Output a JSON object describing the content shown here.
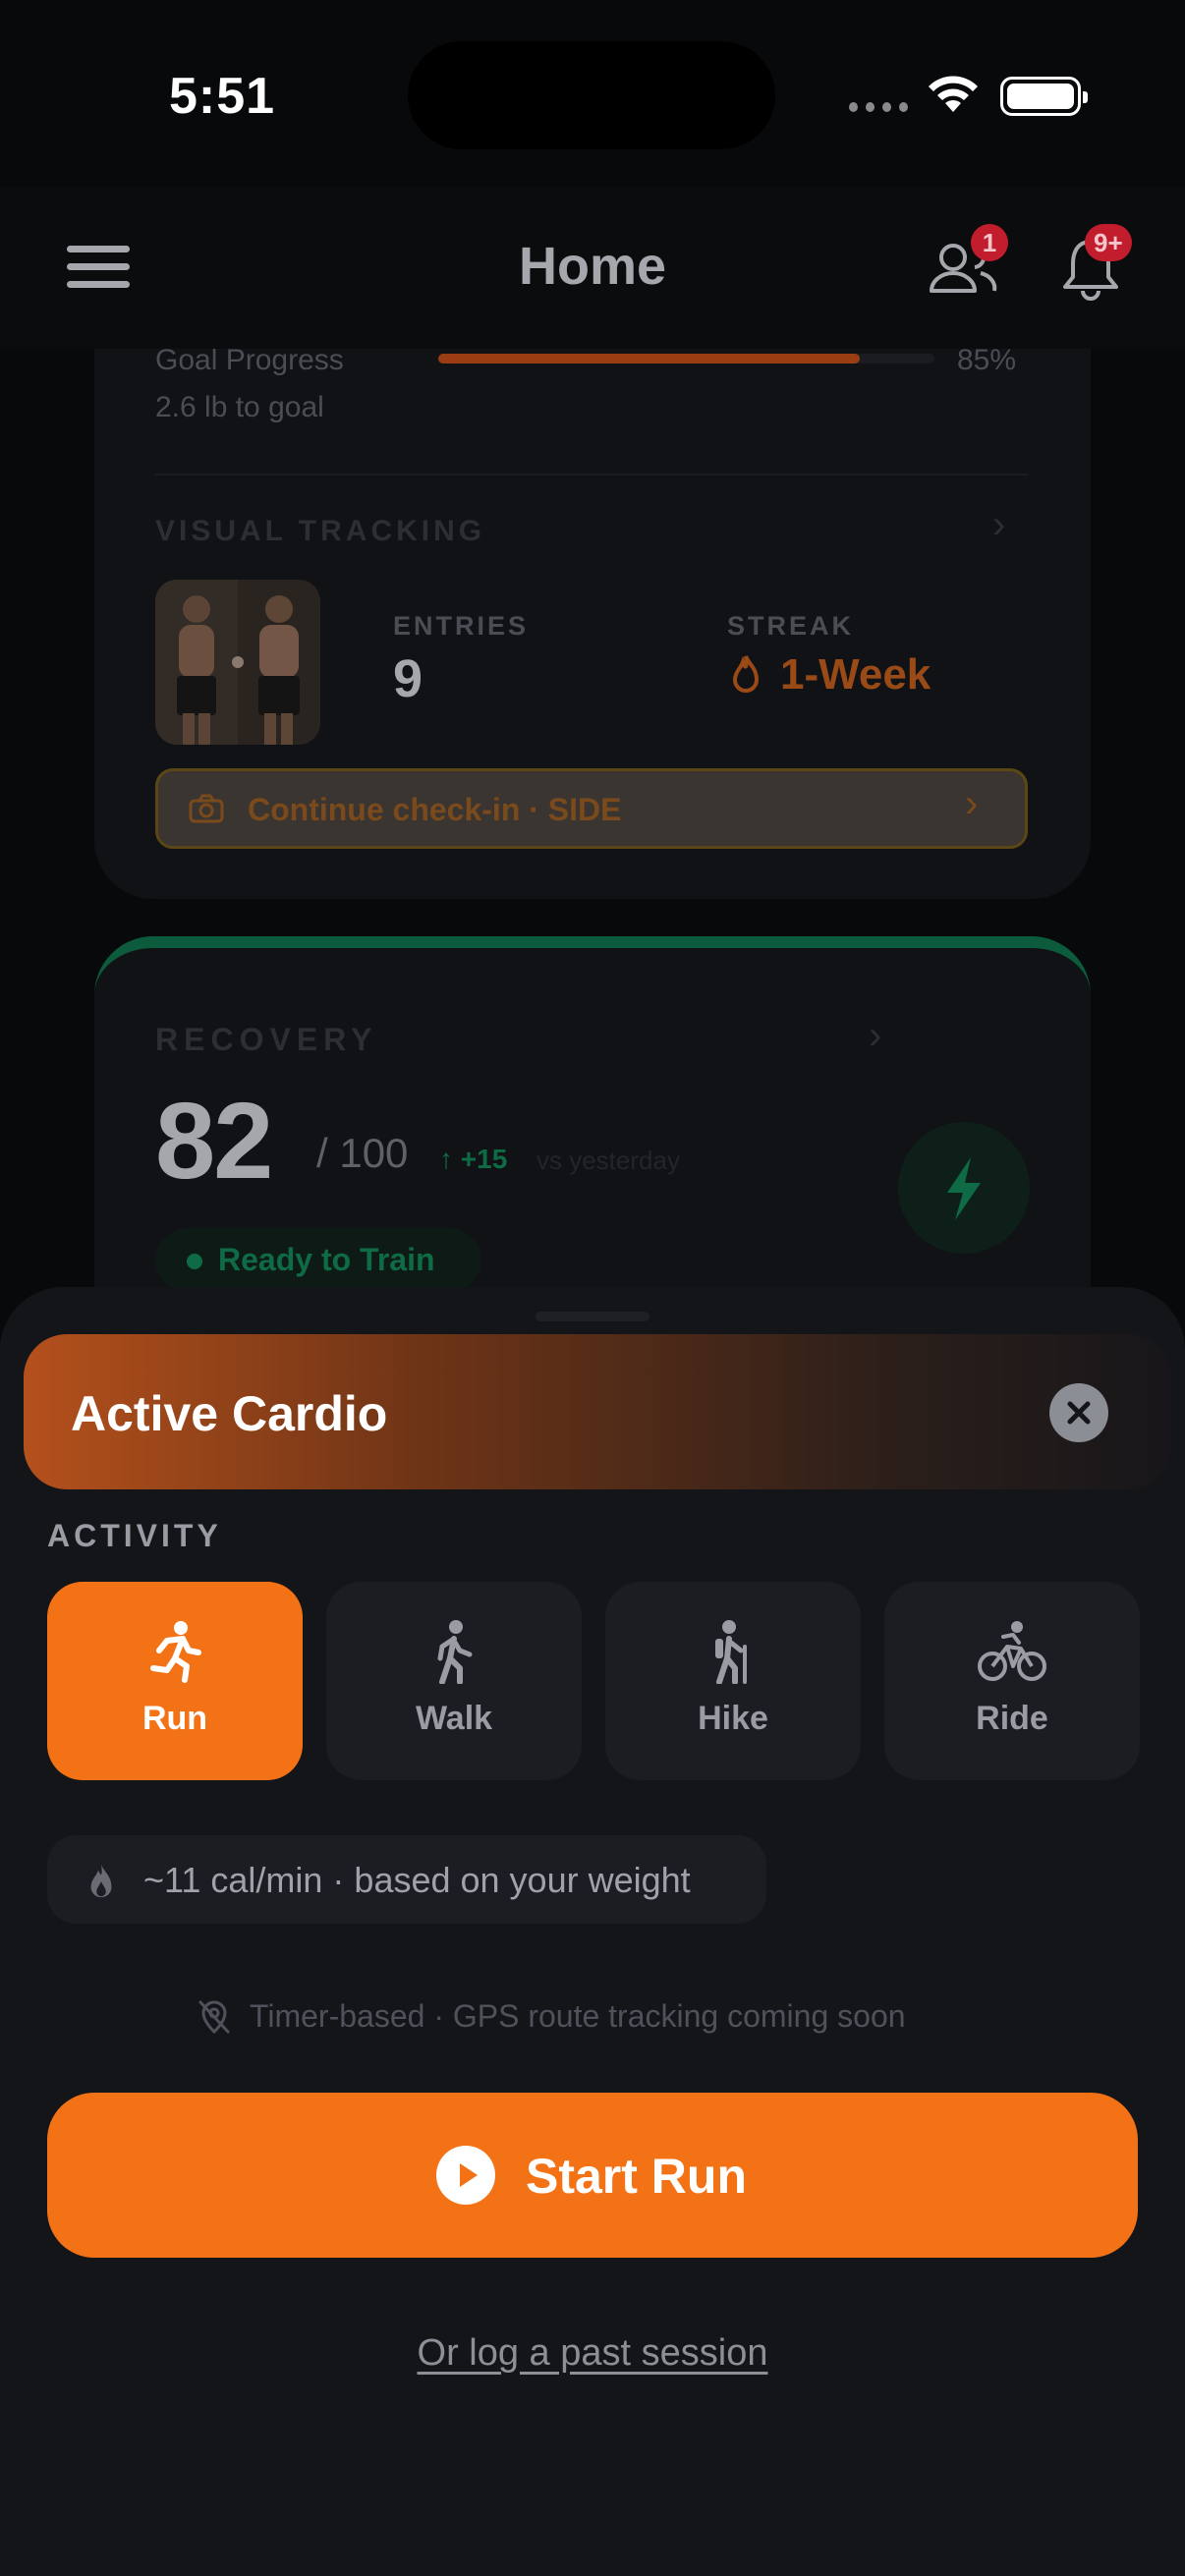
{
  "status_bar": {
    "time": "5:51"
  },
  "header": {
    "title": "Home",
    "friends_badge": "1",
    "notifications_badge": "9+"
  },
  "goal": {
    "label": "Goal Progress",
    "sub": "2.6 lb to goal",
    "percent_text": "85%",
    "progress": 0.85
  },
  "visual_tracking": {
    "label": "VISUAL TRACKING",
    "entries_label": "ENTRIES",
    "entries_value": "9",
    "streak_label": "STREAK",
    "streak_value": "1-Week",
    "checkin_label": "Continue check-in · SIDE"
  },
  "recovery": {
    "label": "RECOVERY",
    "score": "82",
    "max": "/ 100",
    "delta": "↑ +15",
    "delta_suffix": "vs yesterday",
    "status": "Ready to Train"
  },
  "sheet": {
    "title": "Active Cardio",
    "activity_label": "ACTIVITY",
    "activities": [
      {
        "label": "Run",
        "icon": "run-icon",
        "selected": true
      },
      {
        "label": "Walk",
        "icon": "walk-icon",
        "selected": false
      },
      {
        "label": "Hike",
        "icon": "hike-icon",
        "selected": false
      },
      {
        "label": "Ride",
        "icon": "bike-icon",
        "selected": false
      }
    ],
    "calorie_text": "~11 cal/min · based on your weight",
    "gps_note": "Timer-based · GPS route tracking coming soon",
    "start_label": "Start Run",
    "past_session_link": "Or log a past session"
  },
  "colors": {
    "accent": "#f47216",
    "background": "#08090b",
    "sheet": "#141519",
    "recovery_green": "#0f6b45"
  }
}
